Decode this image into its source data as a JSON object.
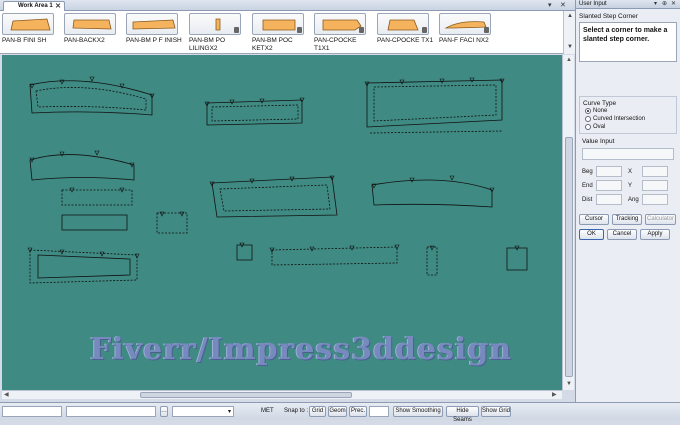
{
  "tabs": {
    "active": "Work Area 1"
  },
  "pieces": [
    {
      "label": "PAN-B FINI SH"
    },
    {
      "label": "PAN-BACKX2"
    },
    {
      "label": "PAN-BM P F INISH"
    },
    {
      "label": "PAN-BM PO LILINGX2"
    },
    {
      "label": "PAN-BM POC KETX2"
    },
    {
      "label": "PAN-CPOCKE T1X1"
    },
    {
      "label": "PAN-CPOCKE TX1"
    },
    {
      "label": "PAN-F FACI NX2"
    }
  ],
  "canvas": {
    "watermark": "Fiverr/Impress3ddesign",
    "background": "#3f8a83"
  },
  "panel": {
    "title": "User Input",
    "command": "Slanted Step Corner",
    "message": "Select a corner to make a slanted step corner.",
    "curve_type_label": "Curve Type",
    "curve_options": [
      "None",
      "Curved Intersection",
      "Oval"
    ],
    "curve_selected": "None",
    "value_input_label": "Value Input",
    "fields": {
      "beg": "Beg",
      "x": "X",
      "end": "End",
      "y": "Y",
      "dist": "Dist",
      "ang": "Ang"
    },
    "cursor_btn": "Cursor",
    "tracking_btn": "Tracking",
    "calculator_btn": "Calculator",
    "ok_btn": "OK",
    "cancel_btn": "Cancel",
    "apply_btn": "Apply"
  },
  "status": {
    "units": "MET",
    "snap_label": "Snap to :",
    "grid_btn": "Grid",
    "geom_btn": "Geom",
    "prec_btn": "Prec.",
    "show_smoothing_btn": "Show Smoothing",
    "hide_seams_btn": "Hide Seams",
    "show_grid_btn": "Show Grid"
  }
}
